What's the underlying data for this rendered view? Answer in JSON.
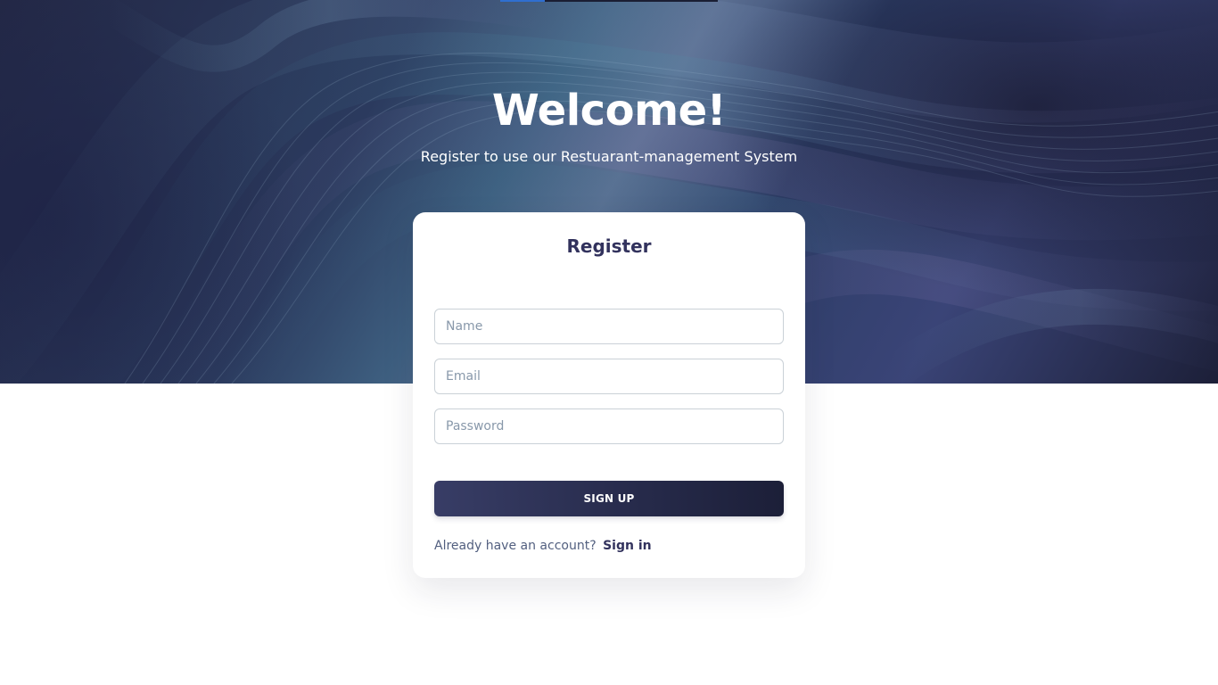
{
  "hero": {
    "title": "Welcome!",
    "subtitle": "Register to use our Restuarant-management System"
  },
  "card": {
    "title": "Register",
    "fields": {
      "name_placeholder": "Name",
      "email_placeholder": "Email",
      "password_placeholder": "Password"
    },
    "signup_label": "SIGN UP",
    "signin_prompt": "Already have an account?",
    "signin_link": "Sign in"
  },
  "colors": {
    "hero_dark": "#232846",
    "hero_teal": "#3e5f80",
    "hero_purple": "#3a4477",
    "accent_blue": "#2f6fd0",
    "button_start": "#383d66",
    "button_end": "#1c1f38",
    "heading_text": "#32325d",
    "body_text": "#525f7f"
  }
}
